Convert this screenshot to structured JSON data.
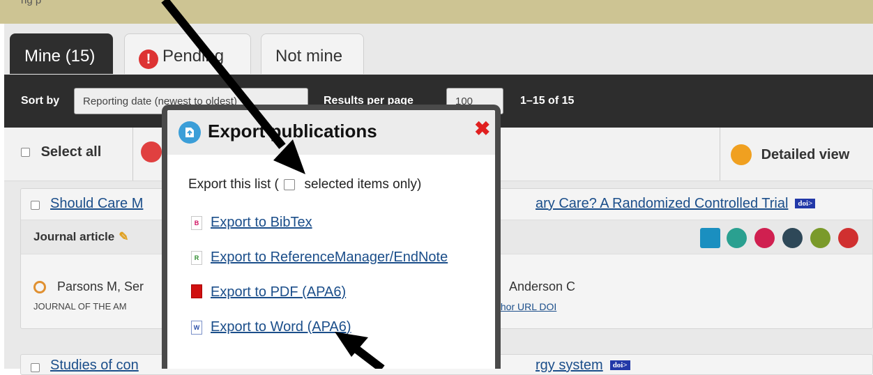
{
  "topbar": {
    "partial_text": "ng p"
  },
  "tabs": [
    {
      "label": "Mine (15)"
    },
    {
      "label": "Pending"
    },
    {
      "label": "Not mine"
    }
  ],
  "sortbar": {
    "sort_label": "Sort by",
    "sort_value": "Reporting date (newest to oldest)",
    "per_page_label": "Results per page",
    "per_page_value": "100",
    "range_text": "1–15 of 15"
  },
  "toolbar": {
    "select_all": "Select all",
    "detailed_view": "Detailed view"
  },
  "publications": [
    {
      "title": "Should Care Managers for Older Adults Be Located in Primary Care? A Randomized Controlled Trial",
      "title_visible_left": "Should Care M",
      "title_visible_right": "ary Care? A Randomized Controlled Trial",
      "type": "Journal article",
      "authors_left": "Parsons M, Ser",
      "authors_right": "Anderson C",
      "journal_left": "JOURNAL OF THE AM",
      "links": "thor URL DOI",
      "doi_badge": "doi>"
    },
    {
      "title_visible_left": "Studies of con",
      "title_visible_right": "rgy system",
      "doi_badge": "doi>"
    }
  ],
  "modal": {
    "title": "Export publications",
    "close_label": "✖",
    "export_this_list": "Export this list (",
    "selected_only": "selected items only)",
    "options": [
      {
        "label": "Export to BibTex",
        "icon": "bibtex-file-icon",
        "glyph": "B",
        "color": "#d01060"
      },
      {
        "label": "Export to ReferenceManager/EndNote",
        "icon": "endnote-file-icon",
        "glyph": "R",
        "color": "#2e8b2e"
      },
      {
        "label": "Export to PDF (APA6)",
        "icon": "pdf-file-icon",
        "glyph": "",
        "color": "#d01010"
      },
      {
        "label": "Export to Word (APA6)",
        "icon": "word-file-icon",
        "glyph": "W",
        "color": "#2a4fa8"
      }
    ]
  },
  "colors": {
    "topbar": "#cdc493",
    "dark_bar": "#2d2d2d",
    "link": "#1b4e8a",
    "danger": "#e02020",
    "modal_icon": "#3b9ed8"
  }
}
